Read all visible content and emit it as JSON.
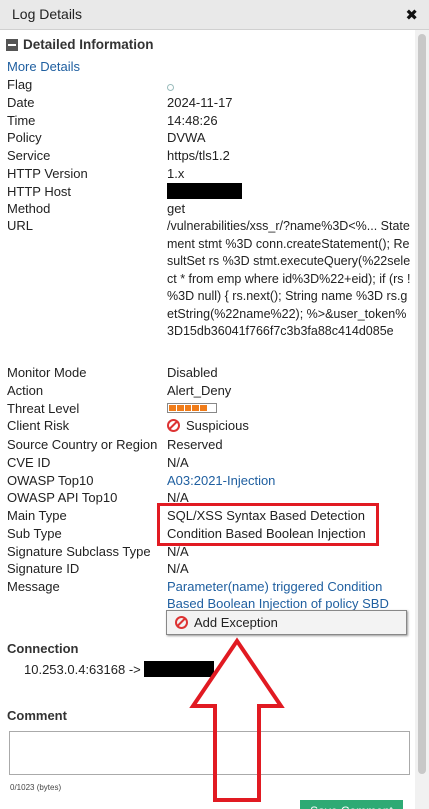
{
  "window": {
    "title": "Log Details",
    "close_icon": "close-icon"
  },
  "section": {
    "title": "Detailed Information",
    "toggle_icon": "minus-square-icon"
  },
  "more_details_link": "More Details",
  "fields": {
    "flag": {
      "label": "Flag"
    },
    "date": {
      "label": "Date",
      "value": "2024-11-17"
    },
    "time": {
      "label": "Time",
      "value": "14:48:26"
    },
    "policy": {
      "label": "Policy",
      "value": "DVWA"
    },
    "service": {
      "label": "Service",
      "value": "https/tls1.2"
    },
    "http_version": {
      "label": "HTTP Version",
      "value": "1.x"
    },
    "http_host": {
      "label": "HTTP Host"
    },
    "method": {
      "label": "Method",
      "value": "get"
    },
    "url": {
      "label": "URL",
      "value": "/vulnerabilities/xss_r/?name%3D<%... Statement stmt %3D conn.createStatement(); ResultSet rs %3D stmt.executeQuery(%22select * from emp where id%3D%22+eid); if (rs !%3D null) { rs.next(); String name %3D rs.getString(%22name%22); %>&user_token%3D15db36041f766f7c3b3fa88c414d085e"
    },
    "monitor_mode": {
      "label": "Monitor Mode",
      "value": "Disabled"
    },
    "action": {
      "label": "Action",
      "value": "Alert_Deny"
    },
    "threat_level": {
      "label": "Threat Level",
      "level_fraction": 0.8,
      "color": "#f07c1a"
    },
    "client_risk": {
      "label": "Client Risk",
      "value": "Suspicious",
      "icon": "ban-icon",
      "color": "#dd3333"
    },
    "source_country": {
      "label": "Source Country or Region",
      "value": "Reserved"
    },
    "cve_id": {
      "label": "CVE ID",
      "value": "N/A"
    },
    "owasp_top10": {
      "label": "OWASP Top10",
      "value": "A03:2021-Injection"
    },
    "owasp_api_top10": {
      "label": "OWASP API Top10",
      "value": "N/A"
    },
    "main_type": {
      "label": "Main Type",
      "value": "SQL/XSS Syntax Based Detection"
    },
    "sub_type": {
      "label": "Sub Type",
      "value": "Condition Based Boolean Injection"
    },
    "signature_subclass_type": {
      "label": "Signature Subclass Type",
      "value": "N/A"
    },
    "signature_id": {
      "label": "Signature ID",
      "value": "N/A"
    },
    "message": {
      "label": "Message",
      "value": "Parameter(name) triggered Condition Based Boolean Injection of policy SBD"
    }
  },
  "add_exception": {
    "label": "Add Exception",
    "icon": "ban-icon"
  },
  "connection": {
    "title": "Connection",
    "source": "10.253.0.4:63168 ->"
  },
  "comment": {
    "title": "Comment",
    "placeholder": "",
    "char_count": "0/1023 (bytes)"
  },
  "save_button": {
    "label": "Save Comment"
  },
  "colors": {
    "accent_link": "#1f5fa0",
    "highlight": "#e11a22",
    "save_button": "#2eaa74"
  }
}
